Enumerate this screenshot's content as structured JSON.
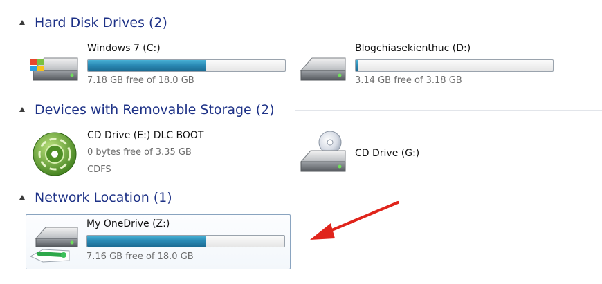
{
  "groups": {
    "hard_disks": {
      "title": "Hard Disk Drives (2)",
      "items": [
        {
          "name": "Windows 7 (C:)",
          "free_text": "7.18 GB free of 18.0 GB",
          "used_fraction": 0.6
        },
        {
          "name": "Blogchiasekienthuc (D:)",
          "free_text": "3.14 GB free of 3.18 GB",
          "used_fraction": 0.01
        }
      ]
    },
    "removable": {
      "title": "Devices with Removable Storage (2)",
      "items": [
        {
          "name": "CD Drive (E:) DLC BOOT",
          "free_text": "0 bytes free of 3.35 GB",
          "filesystem": "CDFS"
        },
        {
          "name": "CD Drive (G:)"
        }
      ]
    },
    "network": {
      "title": "Network Location (1)",
      "items": [
        {
          "name": "My OneDrive (Z:)",
          "free_text": "7.16 GB free of 18.0 GB",
          "used_fraction": 0.6
        }
      ]
    }
  },
  "icons": {
    "c_drive": "windows-hard-drive-icon",
    "d_drive": "hard-drive-icon",
    "e_drive": "green-gear-disc-icon",
    "g_drive": "cd-drive-icon",
    "z_drive": "network-drive-icon"
  },
  "colors": {
    "group_title": "#1e3287",
    "bar_fill": "#2a8ab5",
    "annotation_arrow": "#e0241b"
  }
}
